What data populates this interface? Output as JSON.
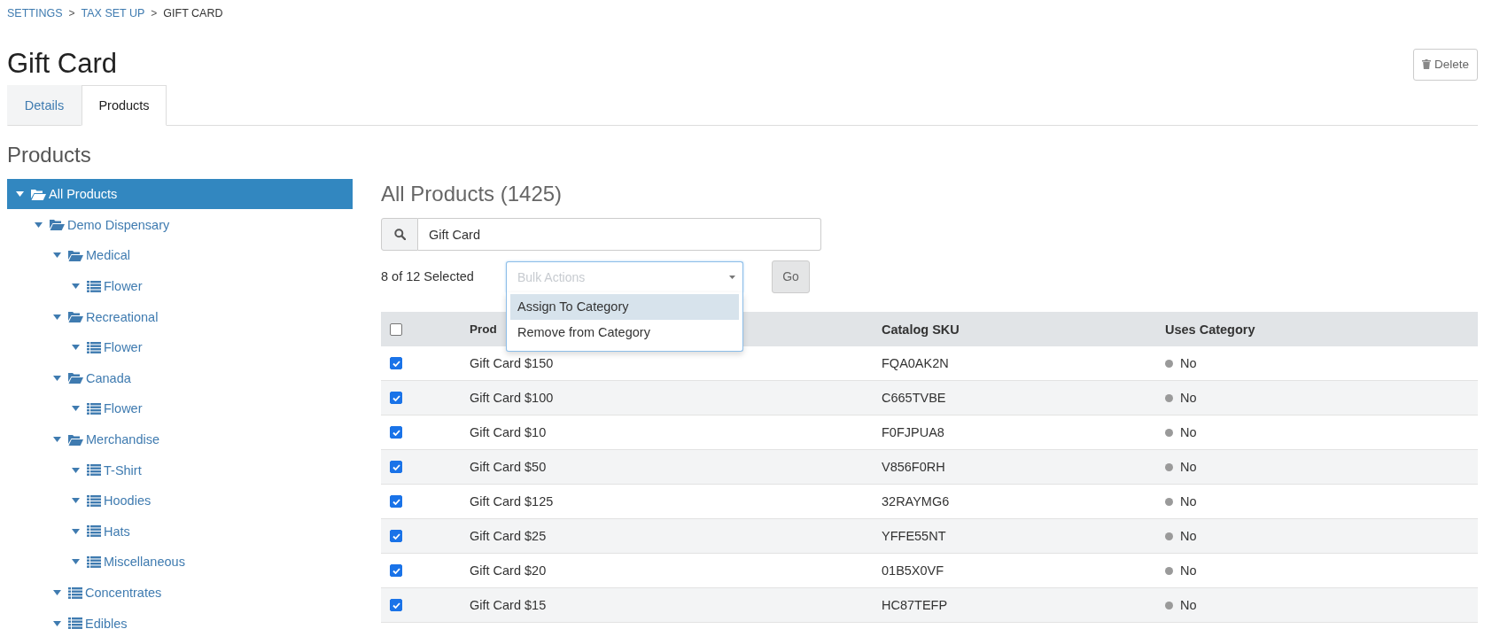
{
  "breadcrumb": [
    {
      "label": "SETTINGS",
      "current": false
    },
    {
      "label": "TAX SET UP",
      "current": false
    },
    {
      "label": "GIFT CARD",
      "current": true
    }
  ],
  "breadcrumb_separator": ">",
  "title": "Gift Card",
  "delete_button": "Delete",
  "tabs": [
    {
      "label": "Details",
      "selected": false
    },
    {
      "label": "Products",
      "selected": true
    }
  ],
  "section_title": "Products",
  "tree": [
    {
      "label": "All Products",
      "kind": "folder",
      "expanded": true,
      "selected": true,
      "children": [
        {
          "label": "Demo Dispensary",
          "kind": "folder",
          "expanded": true,
          "selected": false,
          "children": [
            {
              "label": "Medical",
              "kind": "folder",
              "expanded": true,
              "selected": false,
              "children": [
                {
                  "label": "Flower",
                  "kind": "list",
                  "expanded": true,
                  "selected": false
                }
              ]
            },
            {
              "label": "Recreational",
              "kind": "folder",
              "expanded": true,
              "selected": false,
              "children": [
                {
                  "label": "Flower",
                  "kind": "list",
                  "expanded": true,
                  "selected": false
                }
              ]
            },
            {
              "label": "Canada",
              "kind": "folder",
              "expanded": true,
              "selected": false,
              "children": [
                {
                  "label": "Flower",
                  "kind": "list",
                  "expanded": true,
                  "selected": false
                }
              ]
            },
            {
              "label": "Merchandise",
              "kind": "folder",
              "expanded": true,
              "selected": false,
              "children": [
                {
                  "label": "T-Shirt",
                  "kind": "list",
                  "expanded": true,
                  "selected": false
                },
                {
                  "label": "Hoodies",
                  "kind": "list",
                  "expanded": true,
                  "selected": false
                },
                {
                  "label": "Hats",
                  "kind": "list",
                  "expanded": true,
                  "selected": false
                },
                {
                  "label": "Miscellaneous",
                  "kind": "list",
                  "expanded": true,
                  "selected": false
                }
              ]
            },
            {
              "label": "Concentrates",
              "kind": "list",
              "expanded": true,
              "selected": false
            },
            {
              "label": "Edibles",
              "kind": "list",
              "expanded": true,
              "selected": false
            }
          ]
        }
      ]
    }
  ],
  "products_title": "All Products (1425)",
  "search": {
    "value": "Gift Card"
  },
  "selection_count": "8 of 12 Selected",
  "bulk_actions": {
    "placeholder": "Bulk Actions",
    "open": true,
    "options": [
      {
        "label": "Assign To Category",
        "highlighted": true
      },
      {
        "label": "Remove from Category",
        "highlighted": false
      }
    ]
  },
  "go_button": "Go",
  "table": {
    "all_checked": false,
    "columns": [
      "Prod",
      "Catalog SKU",
      "Uses Category"
    ],
    "rows": [
      {
        "checked": true,
        "product": "Gift Card $150",
        "sku": "FQA0AK2N",
        "uses_category": "No"
      },
      {
        "checked": true,
        "product": "Gift Card $100",
        "sku": "C665TVBE",
        "uses_category": "No"
      },
      {
        "checked": true,
        "product": "Gift Card $10",
        "sku": "F0FJPUA8",
        "uses_category": "No"
      },
      {
        "checked": true,
        "product": "Gift Card $50",
        "sku": "V856F0RH",
        "uses_category": "No"
      },
      {
        "checked": true,
        "product": "Gift Card $125",
        "sku": "32RAYMG6",
        "uses_category": "No"
      },
      {
        "checked": true,
        "product": "Gift Card $25",
        "sku": "YFFE55NT",
        "uses_category": "No"
      },
      {
        "checked": true,
        "product": "Gift Card $20",
        "sku": "01B5X0VF",
        "uses_category": "No"
      },
      {
        "checked": true,
        "product": "Gift Card $15",
        "sku": "HC87TEFP",
        "uses_category": "No"
      }
    ]
  }
}
